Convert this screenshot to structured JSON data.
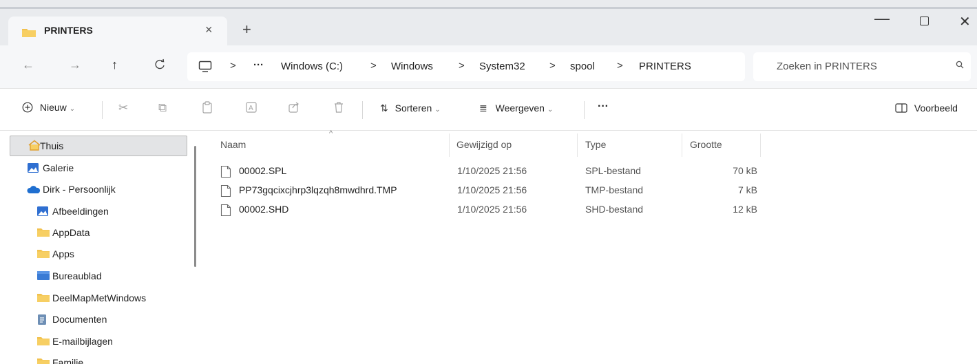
{
  "window": {
    "tab_title": "PRINTERS",
    "tab_close": "×",
    "new_tab": "+",
    "minimize": "—",
    "close": "✕"
  },
  "nav": {
    "back": "←",
    "forward": "→",
    "up": "↑",
    "refresh": "C"
  },
  "address": {
    "more": "···",
    "separator": ">",
    "crumbs": [
      "Windows (C:)",
      "Windows",
      "System32",
      "spool",
      "PRINTERS"
    ]
  },
  "search": {
    "placeholder": "Zoeken in PRINTERS",
    "icon": "search-icon"
  },
  "toolbar": {
    "new_label": "Nieuw",
    "sort_label": "Sorteren",
    "view_label": "Weergeven",
    "more_label": "···",
    "preview_label": "Voorbeeld"
  },
  "sidebar": {
    "items": [
      {
        "label": "Thuis",
        "icon": "home-icon",
        "selected": true
      },
      {
        "label": "Galerie",
        "icon": "gallery-icon"
      },
      {
        "label": "Dirk - Persoonlijk",
        "icon": "cloud-icon"
      },
      {
        "label": "Afbeeldingen",
        "icon": "pictures-icon"
      },
      {
        "label": "AppData",
        "icon": "folder-icon"
      },
      {
        "label": "Apps",
        "icon": "folder-icon"
      },
      {
        "label": "Bureaublad",
        "icon": "desktop-folder-icon"
      },
      {
        "label": "DeelMapMetWindows",
        "icon": "folder-icon"
      },
      {
        "label": "Documenten",
        "icon": "documents-icon"
      },
      {
        "label": "E-mailbijlagen",
        "icon": "folder-icon"
      },
      {
        "label": "Familie",
        "icon": "folder-icon"
      }
    ]
  },
  "files": {
    "columns": {
      "name": "Naam",
      "modified": "Gewijzigd op",
      "type": "Type",
      "size": "Grootte"
    },
    "sort_indicator": "^",
    "rows": [
      {
        "name": "00002.SPL",
        "modified": "1/10/2025 21:56",
        "type": "SPL-bestand",
        "size": "70 kB"
      },
      {
        "name": "PP73gqcixcjhrp3lqzqh8mwdhrd.TMP",
        "modified": "1/10/2025 21:56",
        "type": "TMP-bestand",
        "size": "7 kB"
      },
      {
        "name": "00002.SHD",
        "modified": "1/10/2025 21:56",
        "type": "SHD-bestand",
        "size": "12 kB"
      }
    ]
  },
  "colors": {
    "folder": "#f2c14e",
    "accent_blue": "#2f6fd1",
    "selection": "#e3e4e6"
  }
}
